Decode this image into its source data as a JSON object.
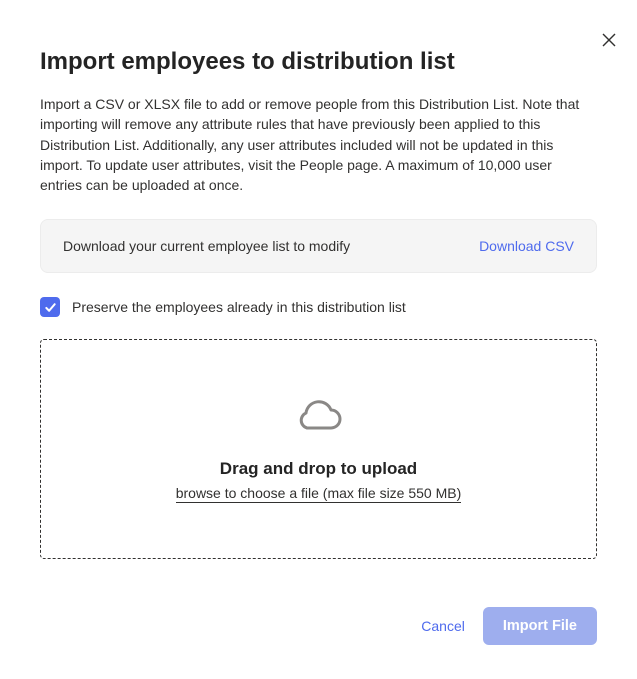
{
  "title": "Import employees to distribution list",
  "description": "Import a CSV or XLSX file to add or remove people from this Distribution List. Note that importing will remove any attribute rules that have previously been applied to this Distribution List. Additionally, any user attributes included will not be updated in this import. To update user attributes, visit the People page. A maximum of 10,000 user entries can be uploaded at once.",
  "banner": {
    "text": "Download your current employee list to modify",
    "link": "Download CSV"
  },
  "preserve": {
    "checked": true,
    "label": "Preserve the employees already in this distribution list"
  },
  "dropzone": {
    "title": "Drag and drop to upload",
    "sub": "browse to choose a file (max file size 550 MB)"
  },
  "footer": {
    "cancel": "Cancel",
    "import": "Import File"
  }
}
